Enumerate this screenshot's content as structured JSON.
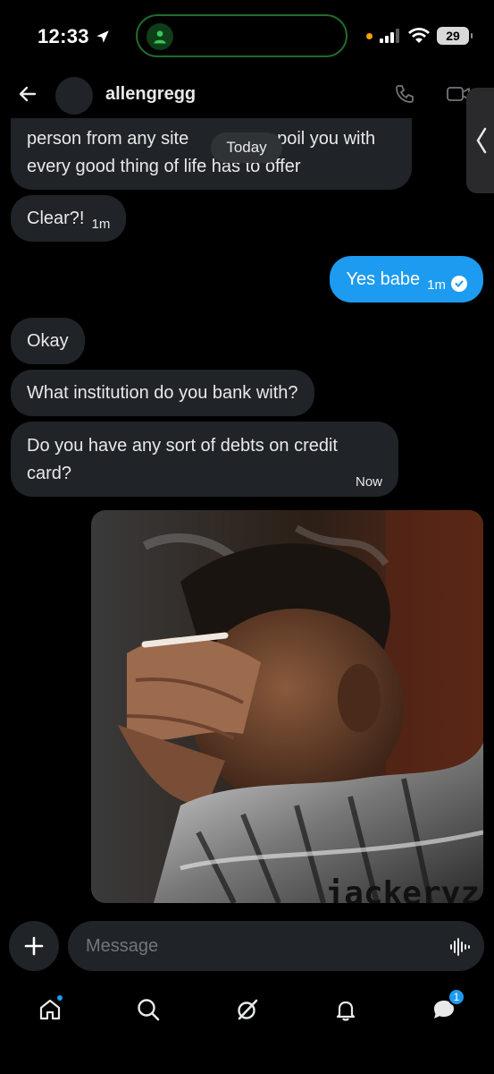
{
  "status_bar": {
    "time": "12:33",
    "battery": "29"
  },
  "header": {
    "username": "allengregg"
  },
  "date_separator": "Today",
  "messages": [
    {
      "direction": "received",
      "line1": "person from any site",
      "line1_end": "spoil you with",
      "line2": "every good thing of life has to offer"
    },
    {
      "direction": "received",
      "text": "Clear?!",
      "time": "1m"
    },
    {
      "direction": "sent",
      "text": "Yes babe",
      "time": "1m"
    },
    {
      "direction": "received",
      "text": "Okay"
    },
    {
      "direction": "received",
      "text": "What institution do you bank with?"
    },
    {
      "direction": "received",
      "text": "Do you have any sort of debts on credit card?",
      "time": "Now"
    }
  ],
  "gif": {
    "watermark": "jackeryz"
  },
  "composer": {
    "placeholder": "Message"
  },
  "tabbar": {
    "messages_badge": "1"
  },
  "colors": {
    "accent": "#1d9bf0",
    "bubble_received": "#202327",
    "background": "#000000"
  },
  "icons": [
    "location-arrow-icon",
    "signal-icon",
    "wifi-icon",
    "back-arrow-icon",
    "phone-icon",
    "video-icon",
    "chevron-left-icon",
    "check-circle-icon",
    "plus-icon",
    "voice-wave-icon",
    "home-icon",
    "search-icon",
    "grok-icon",
    "bell-icon",
    "messages-icon"
  ]
}
